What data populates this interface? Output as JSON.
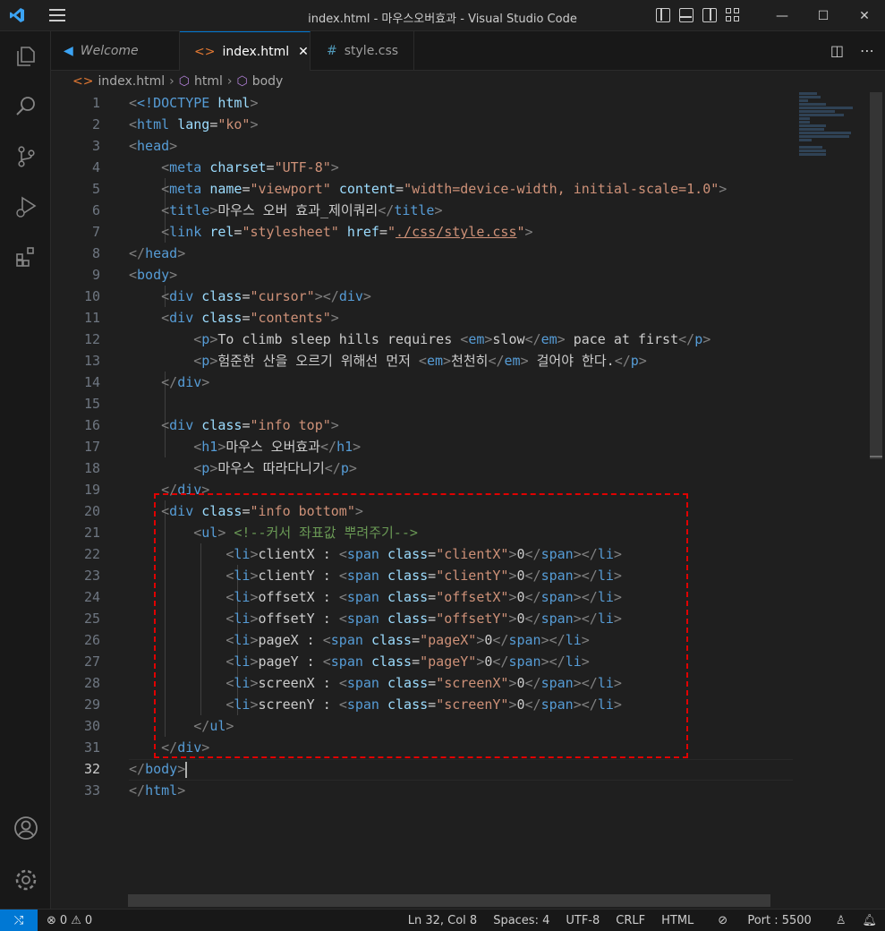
{
  "window": {
    "title": "index.html - 마우스오버효과 - Visual Studio Code",
    "accent_color": "#0078d4"
  },
  "title_controls": {
    "minimize": "—",
    "maximize": "☐",
    "close": "✕"
  },
  "tabs": [
    {
      "label": "Welcome",
      "icon": "vscode-logo-icon"
    },
    {
      "label": "index.html",
      "icon": "html-icon",
      "close": "✕"
    },
    {
      "label": "style.css",
      "icon": "css-hash-icon"
    }
  ],
  "breadcrumb": [
    "index.html",
    "html",
    "body"
  ],
  "editor": {
    "current_line": 32,
    "lines": [
      {
        "n": "1"
      },
      {
        "n": "2"
      },
      {
        "n": "3"
      },
      {
        "n": "4"
      },
      {
        "n": "5"
      },
      {
        "n": "6"
      },
      {
        "n": "7"
      },
      {
        "n": "8"
      },
      {
        "n": "9"
      },
      {
        "n": "10"
      },
      {
        "n": "11"
      },
      {
        "n": "12"
      },
      {
        "n": "13"
      },
      {
        "n": "14"
      },
      {
        "n": "15"
      },
      {
        "n": "16"
      },
      {
        "n": "17"
      },
      {
        "n": "18"
      },
      {
        "n": "19"
      },
      {
        "n": "20"
      },
      {
        "n": "21"
      },
      {
        "n": "22"
      },
      {
        "n": "23"
      },
      {
        "n": "24"
      },
      {
        "n": "25"
      },
      {
        "n": "26"
      },
      {
        "n": "27"
      },
      {
        "n": "28"
      },
      {
        "n": "29"
      },
      {
        "n": "30"
      },
      {
        "n": "31"
      },
      {
        "n": "32"
      },
      {
        "n": "33"
      }
    ],
    "code": {
      "l1_doctype": "<!DOCTYPE",
      "l1_html": "html",
      "l2_tag": "html",
      "l2_attr": "lang",
      "l2_val": "\"ko\"",
      "l3_tag": "head",
      "l4_tag": "meta",
      "l4_attr": "charset",
      "l4_val": "\"UTF-8\"",
      "l5_tag": "meta",
      "l5_attr1": "name",
      "l5_val1": "\"viewport\"",
      "l5_attr2": "content",
      "l5_val2": "\"width=device-width, initial-scale=1.0\"",
      "l6_tag": "title",
      "l6_text": "마우스 오버 효과_제이쿼리",
      "l6_close": "title",
      "l7_tag": "link",
      "l7_attr1": "rel",
      "l7_val1": "\"stylesheet\"",
      "l7_attr2": "href",
      "l7_q1": "\"",
      "l7_path": "./css/style.css",
      "l7_q2": "\"",
      "l8_tag": "head",
      "l9_tag": "body",
      "l10_tag": "div",
      "l10_attr": "class",
      "l10_val": "\"cursor\"",
      "l10_close": "div",
      "l11_tag": "div",
      "l11_attr": "class",
      "l11_val": "\"contents\"",
      "l12_p": "p",
      "l12_text1": "To climb sleep hills requires ",
      "l12_em": "em",
      "l12_text2": "slow",
      "l12_em_close": "em",
      "l12_text3": " pace at first",
      "l12_p_close": "p",
      "l13_p": "p",
      "l13_text1": "험준한 산을 오르기 위해선 먼저 ",
      "l13_em": "em",
      "l13_text2": "천천히",
      "l13_em_close": "em",
      "l13_text3": " 걸어야 한다.",
      "l13_p_close": "p",
      "l14_tag": "div",
      "l16_tag": "div",
      "l16_attr": "class",
      "l16_val": "\"info top\"",
      "l17_h1": "h1",
      "l17_text": "마우스 오버효과",
      "l17_h1_close": "h1",
      "l18_p": "p",
      "l18_text": "마우스 따라다니기",
      "l18_p_close": "p",
      "l19_tag": "div",
      "l20_tag": "div",
      "l20_attr": "class",
      "l20_val": "\"info bottom\"",
      "l21_tag": "ul",
      "l21_comment": "<!--커서 좌표값 뿌려주기-->",
      "li_tag": "li",
      "span_tag": "span",
      "class_attr": "class",
      "zero": "0",
      "l22_label": "clientX : ",
      "l22_val": "\"clientX\"",
      "l23_label": "clientY : ",
      "l23_val": "\"clientY\"",
      "l24_label": "offsetX : ",
      "l24_val": "\"offsetX\"",
      "l25_label": "offsetY : ",
      "l25_val": "\"offsetY\"",
      "l26_label": "pageX : ",
      "l26_val": "\"pageX\"",
      "l27_label": "pageY : ",
      "l27_val": "\"pageY\"",
      "l28_label": "screenX : ",
      "l28_val": "\"screenX\"",
      "l29_label": "screenY : ",
      "l29_val": "\"screenY\"",
      "l30_tag": "ul",
      "l31_tag": "div",
      "l32_tag": "body",
      "l33_tag": "html"
    }
  },
  "statusbar": {
    "errors": "0",
    "warnings": "0",
    "position": "Ln 32, Col 8",
    "spaces": "Spaces: 4",
    "encoding": "UTF-8",
    "eol": "CRLF",
    "language": "HTML",
    "port": "Port : 5500"
  },
  "colors": {
    "tag": "#569cd6",
    "attr": "#9cdcfe",
    "string": "#ce9178",
    "punct": "#808080",
    "comment": "#6a9955",
    "highlight_box": "#e00000"
  }
}
